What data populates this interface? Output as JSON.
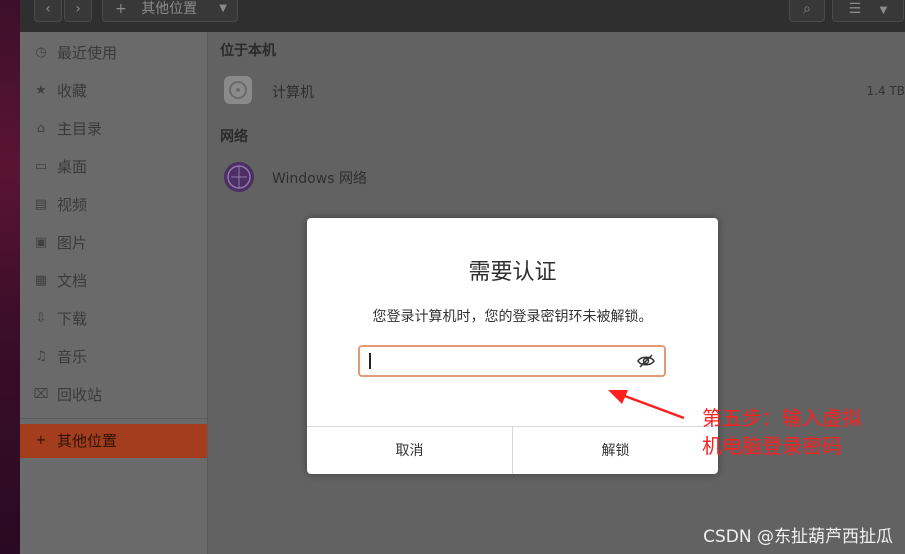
{
  "header": {
    "back_icon": "chevron-left-icon",
    "forward_icon": "chevron-right-icon",
    "path_plus": "+",
    "path_label": "其他位置",
    "search_icon": "search-icon",
    "view_icon": "list-view-icon"
  },
  "sidebar": {
    "items": [
      {
        "icon": "recent-icon",
        "label": "最近使用"
      },
      {
        "icon": "star-icon",
        "label": "收藏"
      },
      {
        "icon": "home-icon",
        "label": "主目录"
      },
      {
        "icon": "desktop-icon",
        "label": "桌面"
      },
      {
        "icon": "video-icon",
        "label": "视频"
      },
      {
        "icon": "picture-icon",
        "label": "图片"
      },
      {
        "icon": "document-icon",
        "label": "文档"
      },
      {
        "icon": "download-icon",
        "label": "下载"
      },
      {
        "icon": "music-icon",
        "label": "音乐"
      },
      {
        "icon": "trash-icon",
        "label": "回收站"
      }
    ],
    "other": {
      "icon": "plus-icon",
      "label": "其他位置"
    }
  },
  "main": {
    "section_local": "位于本机",
    "computer": {
      "label": "计算机",
      "size": "1.4 TB"
    },
    "section_network": "网络",
    "network": {
      "label": "Windows 网络"
    }
  },
  "dialog": {
    "title": "需要认证",
    "message": "您登录计算机时，您的登录密钥环未被解锁。",
    "password_value": "",
    "cancel_label": "取消",
    "unlock_label": "解锁"
  },
  "annotation": {
    "line1": "第五步：输入虚拟",
    "line2": "机电脑登录密码",
    "color": "#ff1f1f"
  },
  "watermark": "CSDN @东扯葫芦西扯瓜"
}
